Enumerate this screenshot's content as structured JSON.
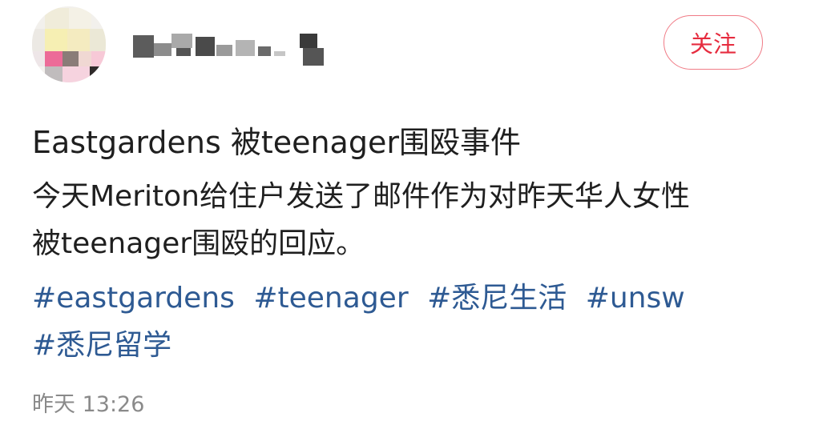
{
  "header": {
    "follow_label": "关注"
  },
  "post": {
    "title": "Eastgardens 被teenager围殴事件",
    "body_lines": [
      "今天Meriton给住户发送了邮件作为对昨天华人女性",
      "被teenager围殴的回应。"
    ],
    "tags_line1": [
      "#eastgardens",
      "#teenager",
      "#悉尼生活",
      "#unsw"
    ],
    "tags_line2": [
      "#悉尼留学"
    ],
    "timestamp": "昨天 13:26"
  },
  "colors": {
    "follow_text": "#e62c3f",
    "follow_border": "#f07b86",
    "tag_link": "#2e5a93",
    "body_text": "#1f1f1f",
    "meta_text": "#8a8a8a"
  },
  "icons": {
    "avatar": "pixelated-avatar",
    "username": "pixelated-username"
  }
}
